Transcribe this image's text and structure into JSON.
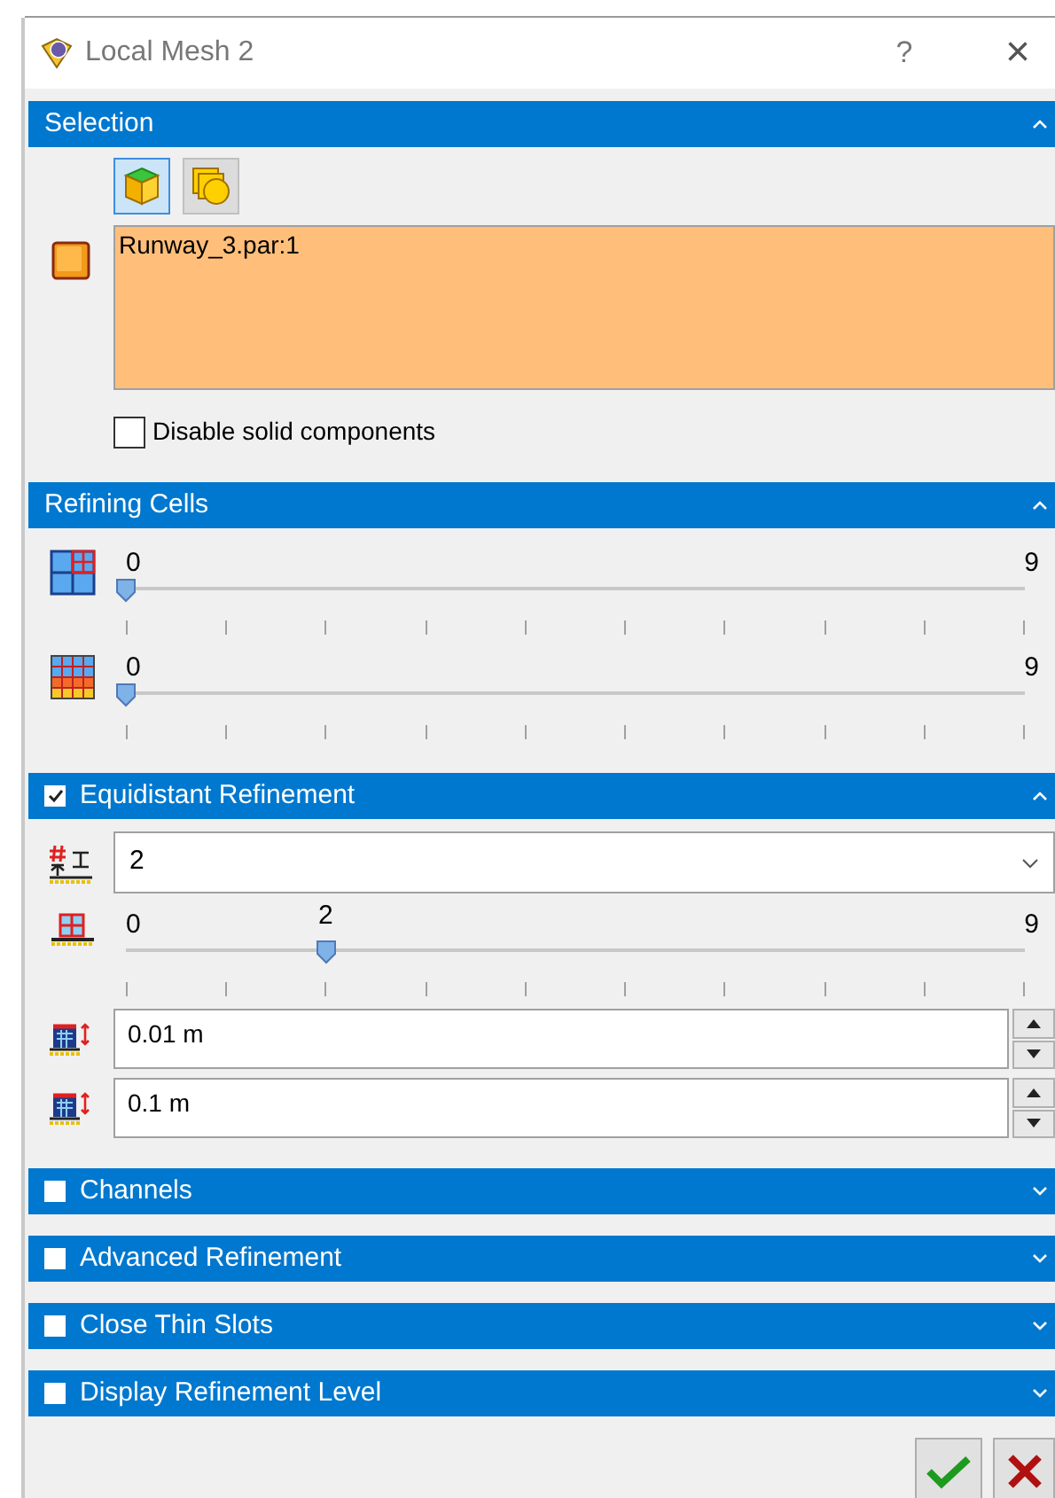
{
  "window": {
    "title": "Local Mesh 2",
    "help": "?",
    "close": "×"
  },
  "sections": [
    {
      "title": "Selection",
      "expanded": true,
      "selection": {
        "filters": [
          {
            "selected": true
          },
          {
            "selected": false
          }
        ],
        "value": "Runway_3.par:1",
        "checkbox": {
          "label": "Disable solid components",
          "checked": false
        }
      }
    },
    {
      "title": "Refining Cells",
      "expanded": true,
      "sliders": [
        {
          "min_label": "0",
          "max_label": "9",
          "level": 0
        },
        {
          "min_label": "0",
          "max_label": "9",
          "level": 0
        }
      ]
    },
    {
      "title": "Equidistant Refinement",
      "checked": true,
      "expanded": true,
      "dropdown": {
        "value": "2"
      },
      "sliders": [
        {
          "min_label": "0",
          "value_label": "2",
          "max_label": "9",
          "level": 0.2222
        }
      ],
      "spin_fields": [
        {
          "value": "0.01 m"
        },
        {
          "value": "0.1 m"
        }
      ]
    },
    {
      "title": "Channels",
      "checked": false,
      "expanded": false
    },
    {
      "title": "Advanced Refinement",
      "checked": false,
      "expanded": false
    },
    {
      "title": "Close Thin Slots",
      "checked": false,
      "expanded": false
    },
    {
      "title": "Display Refinement Level",
      "checked": false,
      "expanded": false
    }
  ]
}
